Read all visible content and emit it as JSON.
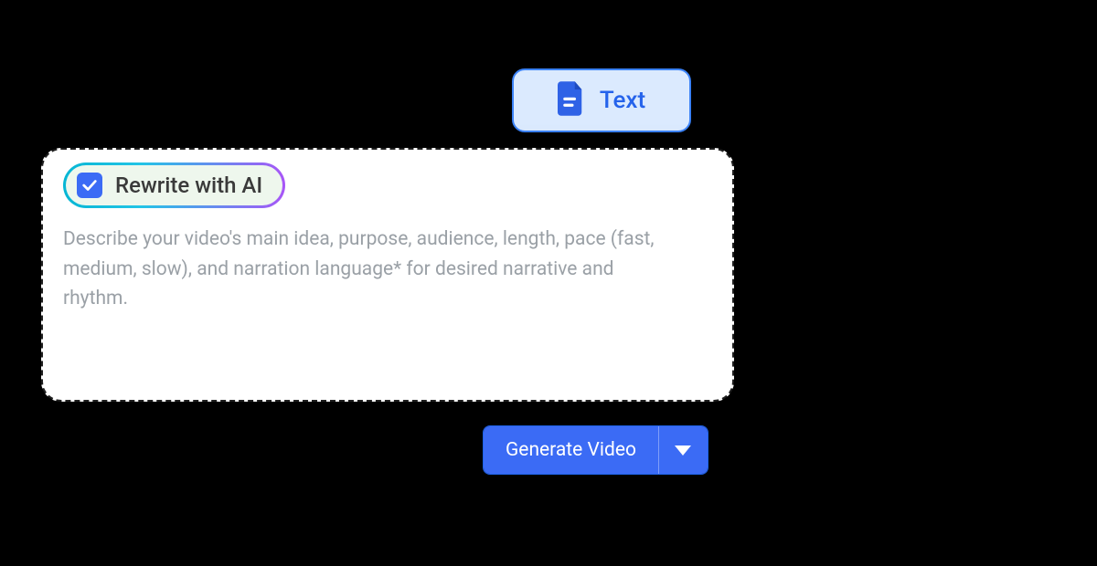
{
  "text_chip": {
    "label": "Text"
  },
  "rewrite": {
    "label": "Rewrite with AI",
    "checked": true
  },
  "editor": {
    "placeholder": "Describe your video's main idea, purpose, audience, length, pace (fast, medium, slow), and narration language* for desired narrative and rhythm."
  },
  "generate": {
    "label": "Generate Video"
  },
  "colors": {
    "primary": "#3b6bf5",
    "chip_bg": "#dbeafe",
    "chip_border": "#3b82f6",
    "gradient_a": "#06b6d4",
    "gradient_b": "#a855f7"
  }
}
